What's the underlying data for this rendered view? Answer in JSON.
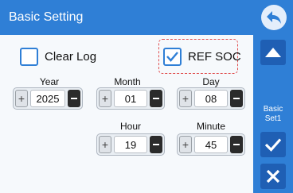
{
  "header": {
    "title": "Basic Setting"
  },
  "options": {
    "clear_log": {
      "label": "Clear Log",
      "checked": false
    },
    "ref_soc": {
      "label": "REF SOC",
      "checked": true
    }
  },
  "fields": {
    "year": {
      "label": "Year",
      "value": "2025"
    },
    "month": {
      "label": "Month",
      "value": "01"
    },
    "day": {
      "label": "Day",
      "value": "08"
    },
    "hour": {
      "label": "Hour",
      "value": "19"
    },
    "minute": {
      "label": "Minute",
      "value": "45"
    }
  },
  "stepper_plus_symbol": "+",
  "side_panel": {
    "basic_set_line1": "Basic",
    "basic_set_line2": "Set1"
  },
  "colors": {
    "header": "#2f7fd6",
    "side_button": "#1f5fb4",
    "highlight_outline": "#e05050"
  },
  "icons": [
    "back-arrow-icon",
    "up-arrow-icon",
    "checkmark-icon",
    "close-icon"
  ]
}
